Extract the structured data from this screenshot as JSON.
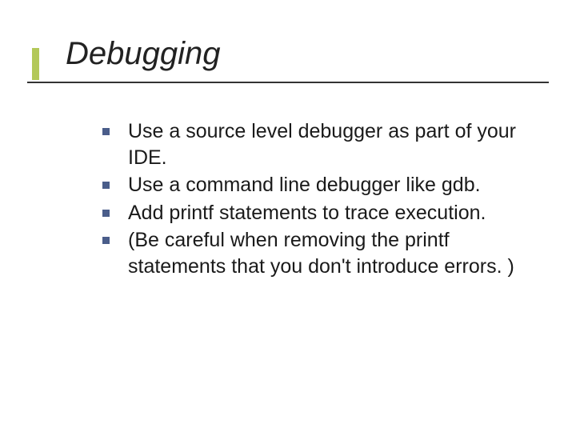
{
  "slide": {
    "title": "Debugging",
    "bullets": [
      "Use a source level debugger as part of your IDE.",
      "Use a command line debugger like gdb.",
      "Add printf statements to trace execution.",
      "(Be careful when removing the printf statements that you don't introduce errors. )"
    ]
  }
}
